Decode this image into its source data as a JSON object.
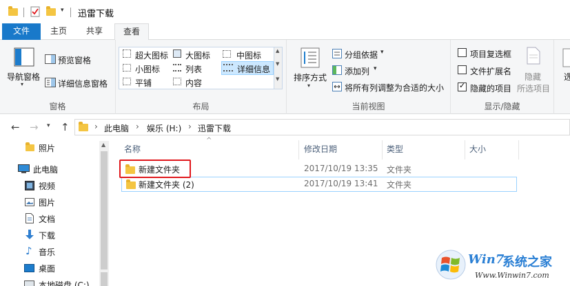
{
  "window": {
    "title": "迅雷下载"
  },
  "tabs": [
    {
      "label": "文件"
    },
    {
      "label": "主页"
    },
    {
      "label": "共享"
    },
    {
      "label": "查看"
    }
  ],
  "ribbon": {
    "pane": {
      "nav_pane": "导航窗格",
      "preview_pane": "预览窗格",
      "details_pane": "详细信息窗格",
      "group_label": "窗格"
    },
    "layout": {
      "items": [
        "超大图标",
        "大图标",
        "中图标",
        "小图标",
        "列表",
        "详细信息",
        "平铺",
        "内容"
      ],
      "selected": "详细信息",
      "group_label": "布局"
    },
    "current_view": {
      "sort_by": "排序方式",
      "group_by": "分组依据",
      "add_column": "添加列",
      "fit_columns": "将所有列调整为合适的大小",
      "group_label": "当前视图"
    },
    "show_hide": {
      "item_checkboxes": "项目复选框",
      "file_extensions": "文件扩展名",
      "hidden_items": "隐藏的项目",
      "item_checkboxes_checked": false,
      "file_extensions_checked": false,
      "hidden_items_checked": true,
      "hide_selected": "隐藏",
      "hide_selected_2": "所选项目",
      "group_label": "显示/隐藏",
      "options_partial": "选"
    }
  },
  "address": {
    "crumbs": [
      "此电脑",
      "娱乐 (H:)",
      "迅雷下载"
    ]
  },
  "navpane": {
    "items": [
      {
        "label": "照片",
        "icon": "folder-icon"
      },
      {
        "label": "此电脑",
        "icon": "computer-icon"
      },
      {
        "label": "视频",
        "icon": "video-icon"
      },
      {
        "label": "图片",
        "icon": "pictures-icon"
      },
      {
        "label": "文档",
        "icon": "document-icon"
      },
      {
        "label": "下载",
        "icon": "download-icon"
      },
      {
        "label": "音乐",
        "icon": "music-icon"
      },
      {
        "label": "桌面",
        "icon": "desktop-icon"
      },
      {
        "label": "本地磁盘 (C:)",
        "icon": "drive-icon"
      }
    ]
  },
  "filelist": {
    "columns": [
      "名称",
      "修改日期",
      "类型",
      "大小"
    ],
    "rows": [
      {
        "name": "新建文件夹",
        "modified": "2017/10/19 13:35",
        "type": "文件夹"
      },
      {
        "name": "新建文件夹 (2)",
        "modified": "2017/10/19 13:41",
        "type": "文件夹"
      }
    ]
  },
  "watermark": {
    "brand_prefix": "Win7",
    "brand_suffix": "系统之家",
    "url": "Www.Winwin7.com"
  },
  "colors": {
    "accent": "#1979ca",
    "folder": "#f4c542",
    "highlight": "#e0161b"
  }
}
